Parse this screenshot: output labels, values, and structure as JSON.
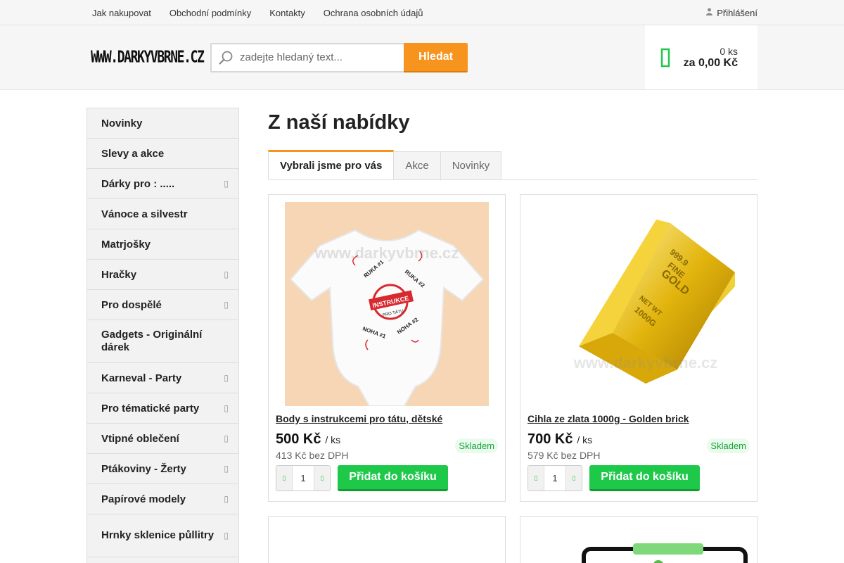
{
  "topbar": {
    "links": [
      "Jak nakupovat",
      "Obchodní podmínky",
      "Kontakty",
      "Ochrana osobních údajů"
    ],
    "login": "Přihlášení",
    "login_icon": "user-icon"
  },
  "header": {
    "logo_text": "WWW.DARKYVBRNE.CZ",
    "search_placeholder": "zadejte hledaný text...",
    "search_button": "Hledat",
    "cart": {
      "count": "0 ks",
      "total": "za 0,00 Kč",
      "icon": "cart-icon"
    }
  },
  "sidebar": {
    "items": [
      {
        "label": "Novinky"
      },
      {
        "label": "Slevy a akce"
      },
      {
        "label": "Dárky pro : ....."
      },
      {
        "label": "Vánoce a silvestr"
      },
      {
        "label": "Matrjošky"
      },
      {
        "label": "Hračky"
      },
      {
        "label": "Pro dospělé"
      },
      {
        "label": "Gadgets - Originální dárek"
      },
      {
        "label": "Karneval - Party"
      },
      {
        "label": "Pro tématické party"
      },
      {
        "label": "Vtipné oblečení"
      },
      {
        "label": "Ptákoviny - Žerty"
      },
      {
        "label": "Papírové modely"
      },
      {
        "label": "Hrnky sklenice půllitry"
      }
    ]
  },
  "main": {
    "title": "Z naší nabídky",
    "tabs": [
      "Vybrali jsme pro vás",
      "Akce",
      "Novinky"
    ],
    "watermark": "www.darkyvbrne.cz",
    "products": [
      {
        "name": "Body s instrukcemi pro tátu, dětské",
        "price": "500 Kč",
        "unit": "/ ks",
        "net_price": "413 Kč bez DPH",
        "stock": "Skladem",
        "qty": "1",
        "add_label": "Přidat do košíku",
        "image_text": {
          "label": "INSTRUKCE",
          "sub": "PRO TÁTU",
          "ruka1": "RUKA #1",
          "ruka2": "RUKA #2",
          "noha1": "NOHA #1",
          "noha2": "NOHA #2"
        }
      },
      {
        "name": "Cihla ze zlata 1000g - Golden brick",
        "price": "700 Kč",
        "unit": "/ ks",
        "net_price": "579 Kč bez DPH",
        "stock": "Skladem",
        "qty": "1",
        "add_label": "Přidat do košíku",
        "image_text": {
          "line1": "999.9",
          "line2": "FINE",
          "line3": "GOLD",
          "line4": "NET WT",
          "line5": "1000G"
        }
      }
    ]
  }
}
